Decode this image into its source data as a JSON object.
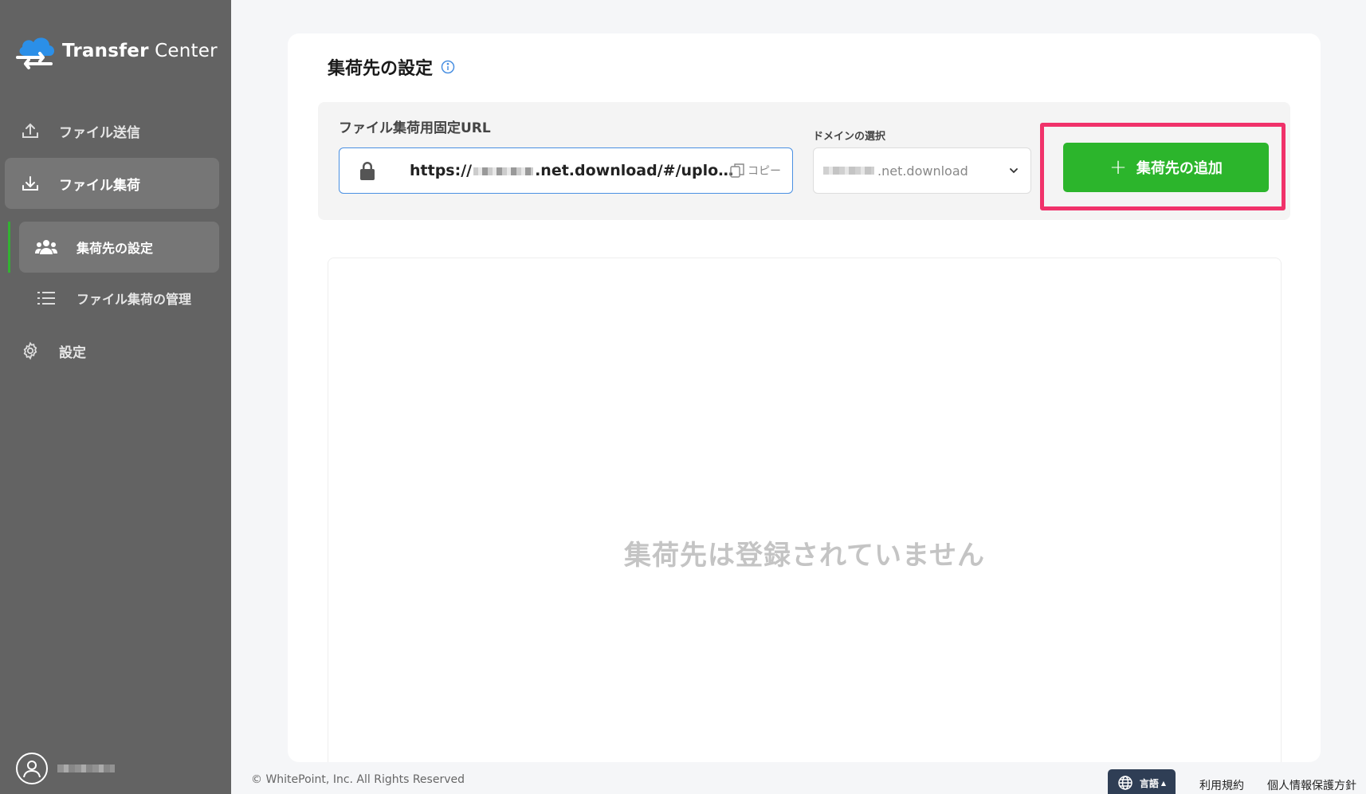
{
  "app": {
    "logo_text_bold": "Transfer",
    "logo_text_regular": " Center"
  },
  "sidebar": {
    "items": [
      {
        "label": "ファイル送信"
      },
      {
        "label": "ファイル集荷"
      },
      {
        "label": "集荷先の設定"
      },
      {
        "label": "ファイル集荷の管理"
      },
      {
        "label": "設定"
      }
    ]
  },
  "main": {
    "title": "集荷先の設定",
    "url_section": {
      "label": "ファイル集荷用固定URL",
      "url_prefix": "https://",
      "url_suffix": ".net.download/#/uploa...",
      "copy_label": "コピー"
    },
    "domain_section": {
      "label": "ドメインの選択",
      "selected_suffix": ".net.download"
    },
    "add_button_label": "集荷先の追加",
    "empty_message": "集荷先は登録されていません"
  },
  "footer": {
    "copyright": "© WhitePoint, Inc. All Rights Reserved",
    "language_label": "言語",
    "terms_label": "利用規約",
    "privacy_label": "個人情報保護方針"
  },
  "colors": {
    "sidebar_bg": "#636363",
    "accent_green": "#2cb52c",
    "highlight_pink": "#f0326a",
    "lang_button_bg": "#2f3e55"
  }
}
